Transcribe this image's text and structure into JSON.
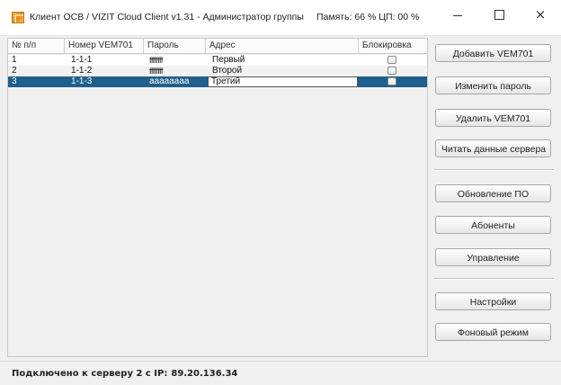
{
  "window": {
    "title": "Клиент ОСВ / VIZIT Cloud Client v1.31 - Администратор группы",
    "stats": "Память: 66 %  ЦП: 00 %",
    "controls": {
      "minimize": "minimize",
      "maximize": "maximize",
      "close": "×"
    }
  },
  "table": {
    "columns": [
      "№ п/п",
      "Номер VEM701",
      "Пароль",
      "Адрес",
      "Блокировка"
    ],
    "rows": [
      {
        "num": "1",
        "vem": "1-1-1",
        "password": "ffffffff",
        "address": "Первый",
        "locked": false
      },
      {
        "num": "2",
        "vem": "1-1-2",
        "password": "ffffffff",
        "address": "Второй",
        "locked": false
      },
      {
        "num": "3",
        "vem": "1-1-3",
        "password": "aaaaaaaa",
        "address": "Третий",
        "locked": false
      }
    ],
    "selected_row": 3
  },
  "sidebar": {
    "buttons": [
      "Добавить VEM701",
      "Изменить пароль",
      "Удалить VEM701",
      "Читать данные сервера",
      "Обновление ПО",
      "Абоненты",
      "Управление",
      "Настройки",
      "Фоновый режим"
    ]
  },
  "status": {
    "label": "Подключено к серверу 2 с IP:",
    "ip": "89.20.136.34"
  },
  "colors": {
    "selection": "#1f5f8b",
    "background": "#f0f0f0"
  }
}
